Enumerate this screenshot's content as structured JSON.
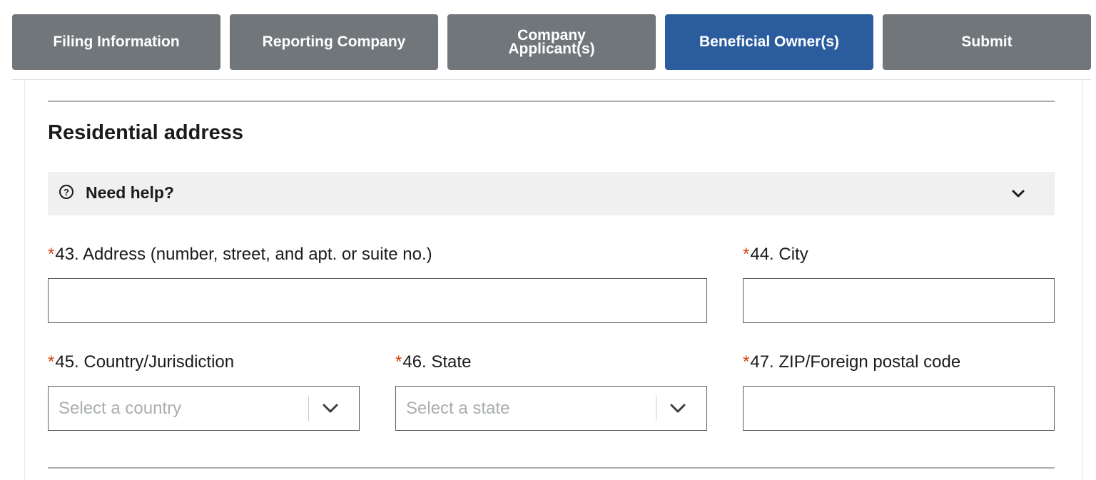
{
  "steps": [
    {
      "label": "Filing Information",
      "active": false
    },
    {
      "label": "Reporting Company",
      "active": false
    },
    {
      "label": "Company Applicant(s)",
      "active": false
    },
    {
      "label": "Beneficial Owner(s)",
      "active": true
    },
    {
      "label": "Submit",
      "active": false
    }
  ],
  "section": {
    "title": "Residential address"
  },
  "help": {
    "icon_glyph": "?",
    "label": "Need help?",
    "icon": "question-circle-icon",
    "chevron": "chevron-down-icon"
  },
  "fields": {
    "required_marker": "*",
    "address": {
      "label": "43. Address (number, street, and apt. or suite no.)",
      "value": ""
    },
    "city": {
      "label": "44. City",
      "value": ""
    },
    "country": {
      "label": "45. Country/Jurisdiction",
      "placeholder": "Select a country"
    },
    "state": {
      "label": "46. State",
      "placeholder": "Select a state"
    },
    "zip": {
      "label": "47. ZIP/Foreign postal code",
      "value": ""
    }
  },
  "colors": {
    "step_inactive": "#71767a",
    "step_active": "#2a5c9e",
    "required": "#d54309",
    "help_bg": "#f0f0f0"
  }
}
